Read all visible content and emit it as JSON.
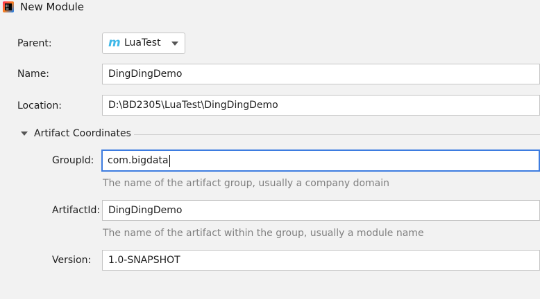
{
  "window": {
    "title": "New Module",
    "app_icon": "intellij-idea-icon"
  },
  "form": {
    "parent": {
      "label": "Parent:",
      "value": "LuaTest",
      "icon": "module-m-icon"
    },
    "name": {
      "label": "Name:",
      "value": "DingDingDemo"
    },
    "location": {
      "label": "Location:",
      "value": "D:\\BD2305\\LuaTest\\DingDingDemo"
    }
  },
  "artifact_section": {
    "title": "Artifact Coordinates",
    "expanded": true,
    "group_id": {
      "label": "GroupId:",
      "value": "com.bigdata",
      "hint": "The name of the artifact group, usually a company domain"
    },
    "artifact_id": {
      "label": "ArtifactId:",
      "value": "DingDingDemo",
      "hint": "The name of the artifact within the group, usually a module name"
    },
    "version": {
      "label": "Version:",
      "value": "1.0-SNAPSHOT"
    }
  },
  "colors": {
    "focus_border": "#3d7ce0",
    "background": "#f2f2f2",
    "hint_text": "#808080",
    "module_icon": "#3fb8e8"
  }
}
